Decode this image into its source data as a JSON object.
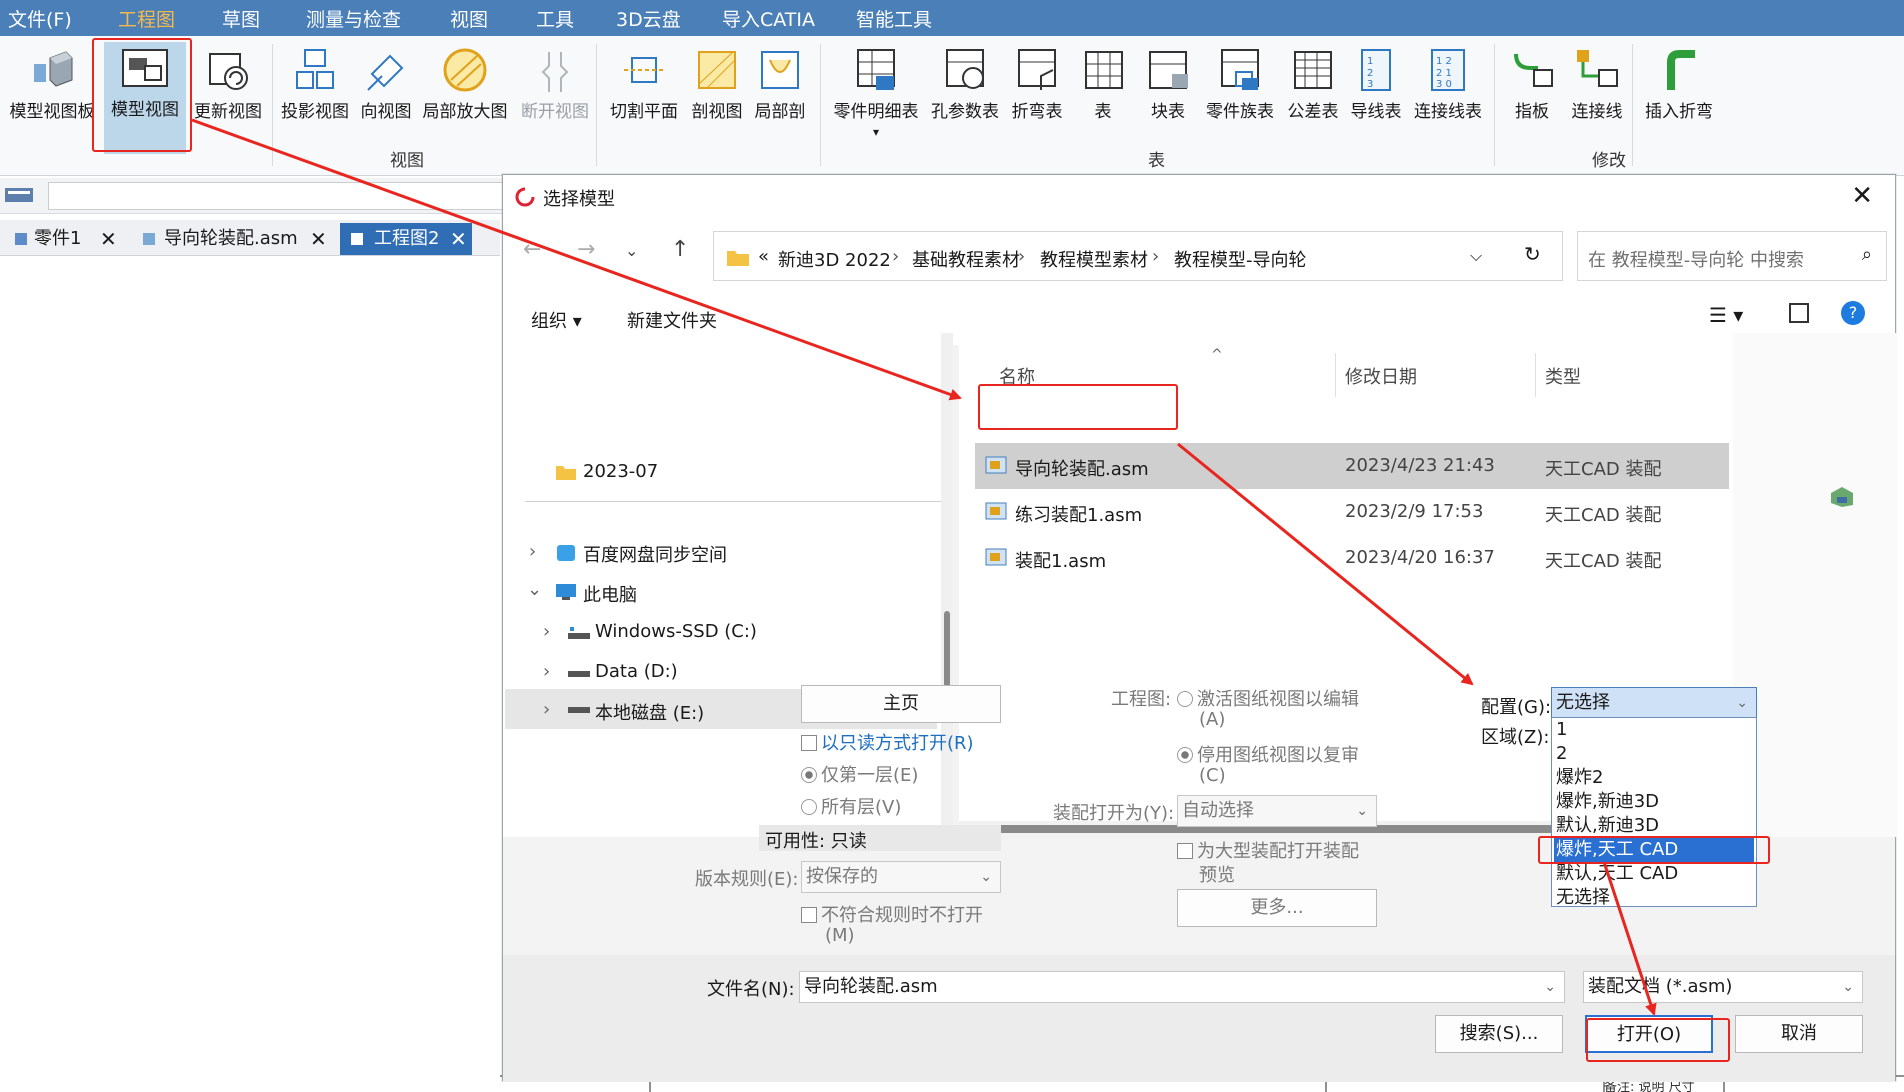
{
  "menu": [
    "文件(F)",
    "工程图",
    "草图",
    "测量与检查",
    "视图",
    "工具",
    "3D云盘",
    "导入CATIA",
    "智能工具"
  ],
  "ribbon": {
    "buttons": [
      "模型视图板",
      "模型视图",
      "更新视图",
      "投影视图",
      "向视图",
      "局部放大图",
      "断开视图",
      "切割平面",
      "剖视图",
      "局部剖",
      "零件明细表",
      "孔参数表",
      "折弯表",
      "表",
      "块表",
      "零件族表",
      "公差表",
      "导线表",
      "连接线表",
      "指板",
      "连接线",
      "插入折弯"
    ],
    "groups": [
      "视图",
      "表",
      "修改"
    ]
  },
  "doc_tabs": [
    "零件1",
    "导向轮装配.asm",
    "工程图2"
  ],
  "dialog": {
    "title": "选择模型",
    "close": "✕",
    "breadcrumbs": [
      "«",
      "新迪3D 2022",
      "基础教程素材",
      "教程模型素材",
      "教程模型-导向轮"
    ],
    "search_placeholder": "在 教程模型-导向轮 中搜索",
    "toolbar": {
      "organize": "组织 ▾",
      "new_folder": "新建文件夹"
    },
    "nav": [
      "2023-07",
      "百度网盘同步空间",
      "此电脑",
      "Windows-SSD (C:)",
      "Data (D:)",
      "本地磁盘 (E:)"
    ],
    "columns": {
      "name": "名称",
      "date": "修改日期",
      "type": "类型"
    },
    "files": [
      {
        "name": "导向轮装配.asm",
        "date": "2023/4/23 21:43",
        "type": "天工CAD 装配"
      },
      {
        "name": "练习装配1.asm",
        "date": "2023/2/9 17:53",
        "type": "天工CAD 装配"
      },
      {
        "name": "装配1.asm",
        "date": "2023/4/20 16:37",
        "type": "天工CAD 装配"
      }
    ],
    "options": {
      "home_button": "主页",
      "readonly": "以只读方式打开(R)",
      "first_level": "仅第一层(E)",
      "all_levels": "所有层(V)",
      "availability": "可用性: 只读",
      "version_rule_label": "版本规则(E):",
      "version_rule_value": "按保存的",
      "noncompliant": "不符合规则时不打开",
      "noncompliant2": "(M)",
      "drawing_label": "工程图:",
      "activate_1": "激活图纸视图以编辑",
      "activate_2": "(A)",
      "disable_1": "停用图纸视图以复审",
      "disable_2": "(C)",
      "assembly_open_label": "装配打开为(Y):",
      "assembly_open_value": "自动选择",
      "large_1": "为大型装配打开装配",
      "large_2": "预览",
      "more_button": "更多...",
      "config_label": "配置(G):",
      "config_value": "无选择",
      "region_label": "区域(Z):",
      "config_options": [
        "1",
        "2",
        "爆炸2",
        "爆炸,新迪3D",
        "默认,新迪3D",
        "爆炸,天工 CAD",
        "默认,天工 CAD",
        "无选择"
      ]
    },
    "filename_label": "文件名(N):",
    "filename_value": "导向轮装配.asm",
    "filetype_value": "装配文档 (*.asm)",
    "search_button": "搜索(S)...",
    "open_button": "打开(O)",
    "cancel_button": "取消"
  },
  "colors": {
    "accent": "#4a7fb8",
    "active_menu": "#f7b84b",
    "annotation": "#e8261f",
    "selection": "#2a6fd2"
  },
  "background_text": "备注: 说明 尺寸"
}
